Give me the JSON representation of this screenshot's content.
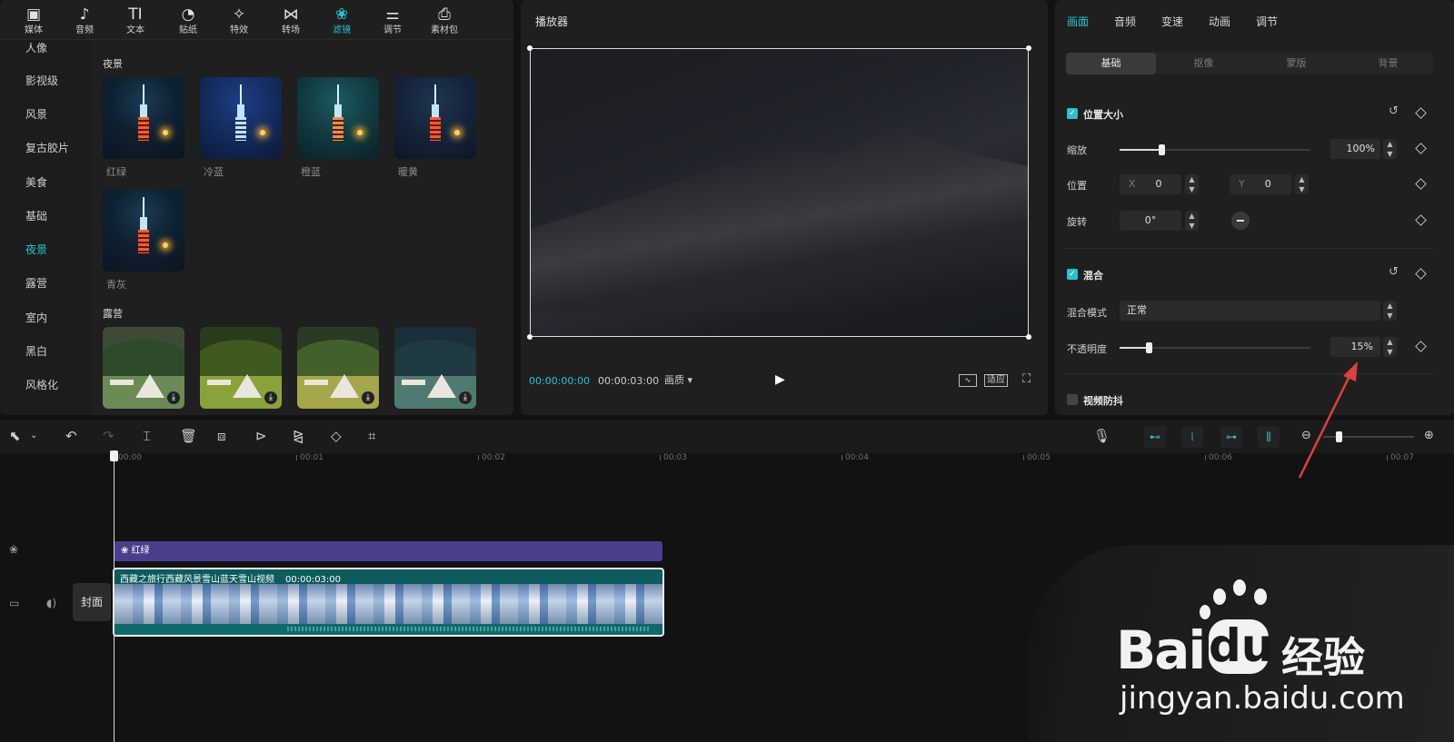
{
  "library": {
    "tabs": [
      {
        "label": "媒体",
        "icon": "media-icon",
        "glyph": "▣"
      },
      {
        "label": "音频",
        "icon": "audio-icon",
        "glyph": "♪"
      },
      {
        "label": "文本",
        "icon": "text-icon",
        "glyph": "TI"
      },
      {
        "label": "贴纸",
        "icon": "sticker-icon",
        "glyph": "◔"
      },
      {
        "label": "特效",
        "icon": "effects-icon",
        "glyph": "✧"
      },
      {
        "label": "转场",
        "icon": "transition-icon",
        "glyph": "⋈"
      },
      {
        "label": "滤镜",
        "icon": "filter-icon",
        "glyph": "❀"
      },
      {
        "label": "调节",
        "icon": "adjust-icon",
        "glyph": "⚌"
      },
      {
        "label": "素材包",
        "icon": "package-icon",
        "glyph": "⎙"
      }
    ],
    "active_tab": "滤镜",
    "categories": [
      "人像",
      "影视级",
      "风景",
      "复古胶片",
      "美食",
      "基础",
      "夜景",
      "露营",
      "室内",
      "黑白",
      "风格化"
    ],
    "active_category": "夜景",
    "sections": {
      "night": {
        "title": "夜景",
        "items": [
          "红绿",
          "冷蓝",
          "橙蓝",
          "暖黄",
          "青灰"
        ]
      },
      "camping": {
        "title": "露营"
      }
    }
  },
  "player": {
    "title": "播放器",
    "current_time": "00:00:00:00",
    "duration": "00:00:03:00",
    "quality_label": "画质",
    "fit_label": "适应"
  },
  "inspector": {
    "tabs": [
      "画面",
      "音频",
      "变速",
      "动画",
      "调节"
    ],
    "active_tab": "画面",
    "subtabs": [
      "基础",
      "抠像",
      "蒙版",
      "背景"
    ],
    "active_subtab": "基础",
    "position_size": {
      "title": "位置大小",
      "scale_label": "缩放",
      "scale_value": "100%",
      "scale_level": 0.22,
      "position_label": "位置",
      "x_label": "X",
      "x_value": "0",
      "y_label": "Y",
      "y_value": "0",
      "rotate_label": "旋转",
      "rotate_value": "0°"
    },
    "blend": {
      "title": "混合",
      "mode_label": "混合模式",
      "mode_value": "正常",
      "opacity_label": "不透明度",
      "opacity_value": "15%",
      "opacity_level": 0.15
    },
    "stabilize": {
      "title": "视频防抖"
    }
  },
  "timeline": {
    "ruler": [
      "00:00",
      "00:01",
      "00:02",
      "00:03",
      "00:04",
      "00:05",
      "00:06",
      "00:07"
    ],
    "filter_clip": "红绿",
    "video_clip_title": "西藏之旅行西藏风景雪山蓝天雪山视频",
    "video_clip_duration": "00:00:03:00",
    "cover_label": "封面"
  },
  "watermark": {
    "brand": "Bai",
    "brand2": "du",
    "suffix": "经验",
    "url": "jingyan.baidu.com"
  },
  "colors": {
    "accent": "#29c4cf",
    "filter_track": "#4a3f8c",
    "video_track": "#0d5b5c",
    "arrow": "#e0403a"
  }
}
